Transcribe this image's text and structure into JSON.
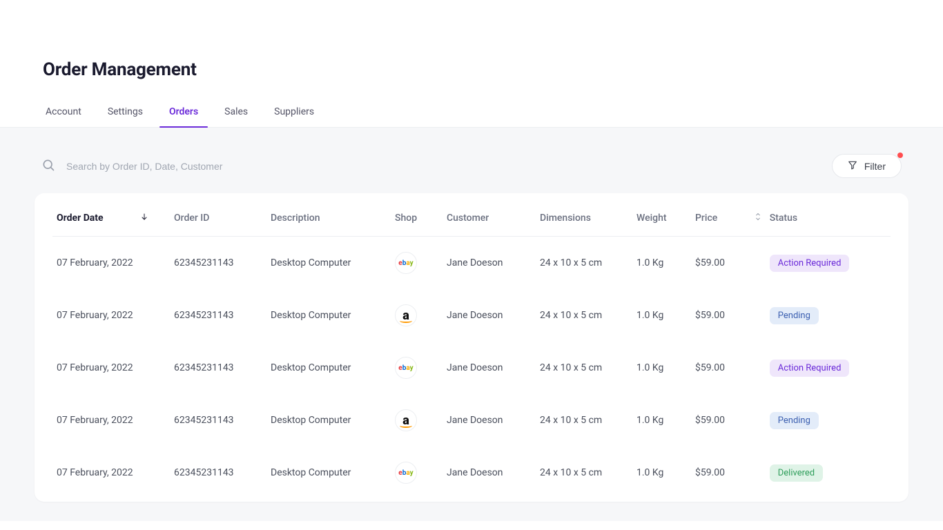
{
  "header": {
    "title": "Order Management"
  },
  "tabs": [
    {
      "label": "Account",
      "active": false
    },
    {
      "label": "Settings",
      "active": false
    },
    {
      "label": "Orders",
      "active": true
    },
    {
      "label": "Sales",
      "active": false
    },
    {
      "label": "Suppliers",
      "active": false
    }
  ],
  "search": {
    "placeholder": "Search by Order ID, Date, Customer"
  },
  "filter": {
    "label": "Filter",
    "has_indicator": true
  },
  "table": {
    "columns": [
      {
        "key": "date",
        "label": "Order Date",
        "sorted": "desc"
      },
      {
        "key": "id",
        "label": "Order ID"
      },
      {
        "key": "desc",
        "label": "Description"
      },
      {
        "key": "shop",
        "label": "Shop"
      },
      {
        "key": "customer",
        "label": "Customer"
      },
      {
        "key": "dim",
        "label": "Dimensions"
      },
      {
        "key": "weight",
        "label": "Weight"
      },
      {
        "key": "price",
        "label": "Price",
        "sortable": true
      },
      {
        "key": "status",
        "label": "Status"
      }
    ],
    "rows": [
      {
        "date": "07 February, 2022",
        "id": "62345231143",
        "desc": "Desktop Computer",
        "shop": "ebay",
        "customer": "Jane Doeson",
        "dim": "24 x 10 x 5 cm",
        "weight": "1.0 Kg",
        "price": "$59.00",
        "status": "Action Required",
        "status_key": "action"
      },
      {
        "date": "07 February, 2022",
        "id": "62345231143",
        "desc": "Desktop Computer",
        "shop": "amazon",
        "customer": "Jane Doeson",
        "dim": "24 x 10 x 5 cm",
        "weight": "1.0 Kg",
        "price": "$59.00",
        "status": "Pending",
        "status_key": "pending"
      },
      {
        "date": "07 February, 2022",
        "id": "62345231143",
        "desc": "Desktop Computer",
        "shop": "ebay",
        "customer": "Jane Doeson",
        "dim": "24 x 10 x 5 cm",
        "weight": "1.0 Kg",
        "price": "$59.00",
        "status": "Action Required",
        "status_key": "action"
      },
      {
        "date": "07 February, 2022",
        "id": "62345231143",
        "desc": "Desktop Computer",
        "shop": "amazon",
        "customer": "Jane Doeson",
        "dim": "24 x 10 x 5 cm",
        "weight": "1.0 Kg",
        "price": "$59.00",
        "status": "Pending",
        "status_key": "pending"
      },
      {
        "date": "07 February, 2022",
        "id": "62345231143",
        "desc": "Desktop Computer",
        "shop": "ebay",
        "customer": "Jane Doeson",
        "dim": "24 x 10 x 5 cm",
        "weight": "1.0 Kg",
        "price": "$59.00",
        "status": "Delivered",
        "status_key": "delivered"
      }
    ]
  }
}
